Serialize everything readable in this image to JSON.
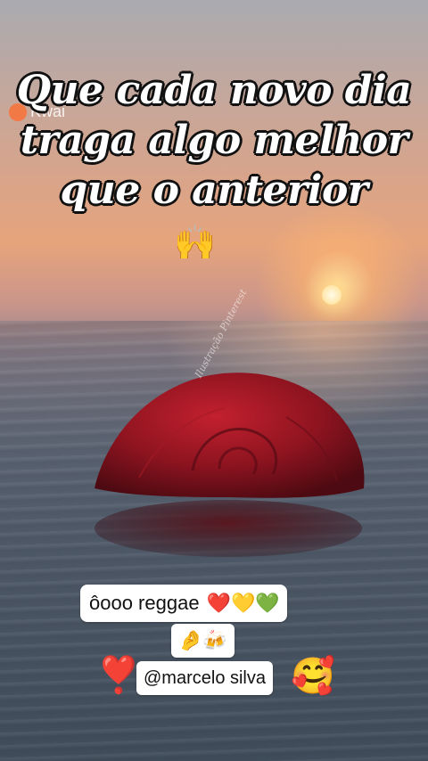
{
  "headline": {
    "line1": "Que cada novo dia",
    "line2": "traga algo melhor",
    "line3": "que o anterior",
    "emoji": "🙌"
  },
  "watermark": {
    "brand": "Kwai",
    "icon": "kwai-logo-icon"
  },
  "rose": {
    "signature": "Ilustração Pinterest",
    "icon": "rose-in-water"
  },
  "comment": {
    "text": "ôooo reggae",
    "emojis": "❤️💛💚",
    "reaction_emojis": "🤌🍻"
  },
  "mention": {
    "prefix_emoji": "❣️",
    "handle": "@marcelo silva",
    "suffix_emoji": "🥰"
  },
  "colors": {
    "sky_top": "#a9aab0",
    "sunset": "#e6a47c",
    "water": "#4b5563",
    "rose": "#8e1420",
    "kwai_orange": "#ff6a2a"
  }
}
